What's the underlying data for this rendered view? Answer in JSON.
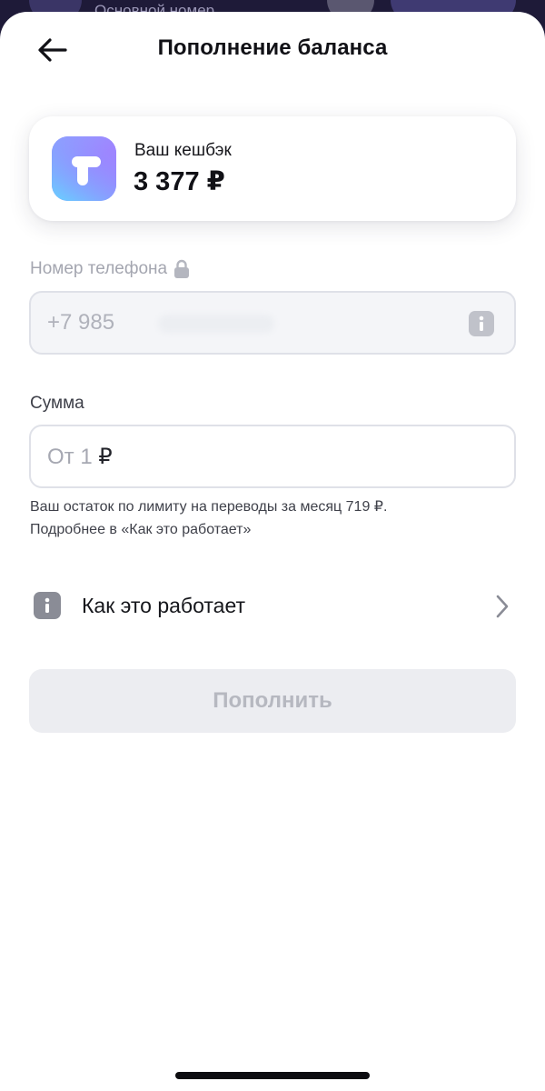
{
  "backdrop": {
    "text": "Основной номер"
  },
  "header": {
    "title": "Пополнение баланса"
  },
  "cashback": {
    "label": "Ваш кешбэк",
    "value": "3 377 ₽"
  },
  "phone_field": {
    "label": "Номер телефона",
    "value": "+7 985"
  },
  "sum_field": {
    "label": "Сумма",
    "placeholder": "От 1",
    "currency": "₽"
  },
  "hint": {
    "line1": "Ваш остаток по лимиту на переводы за месяц 719 ₽.",
    "line2": "Подробнее в «Как это работает»"
  },
  "how_it_works": {
    "label": "Как это работает"
  },
  "submit": {
    "label": "Пополнить"
  },
  "colors": {
    "sheet": "#ffffff",
    "backdrop": "#1e1a38",
    "disabled_button": "#ecedf1",
    "text_primary": "#111116",
    "text_muted": "#a4a6b0"
  },
  "icons": {
    "back": "arrow-left-icon",
    "lock": "lock-icon",
    "info": "info-icon",
    "chevron": "chevron-right-icon",
    "logo": "app-logo"
  }
}
